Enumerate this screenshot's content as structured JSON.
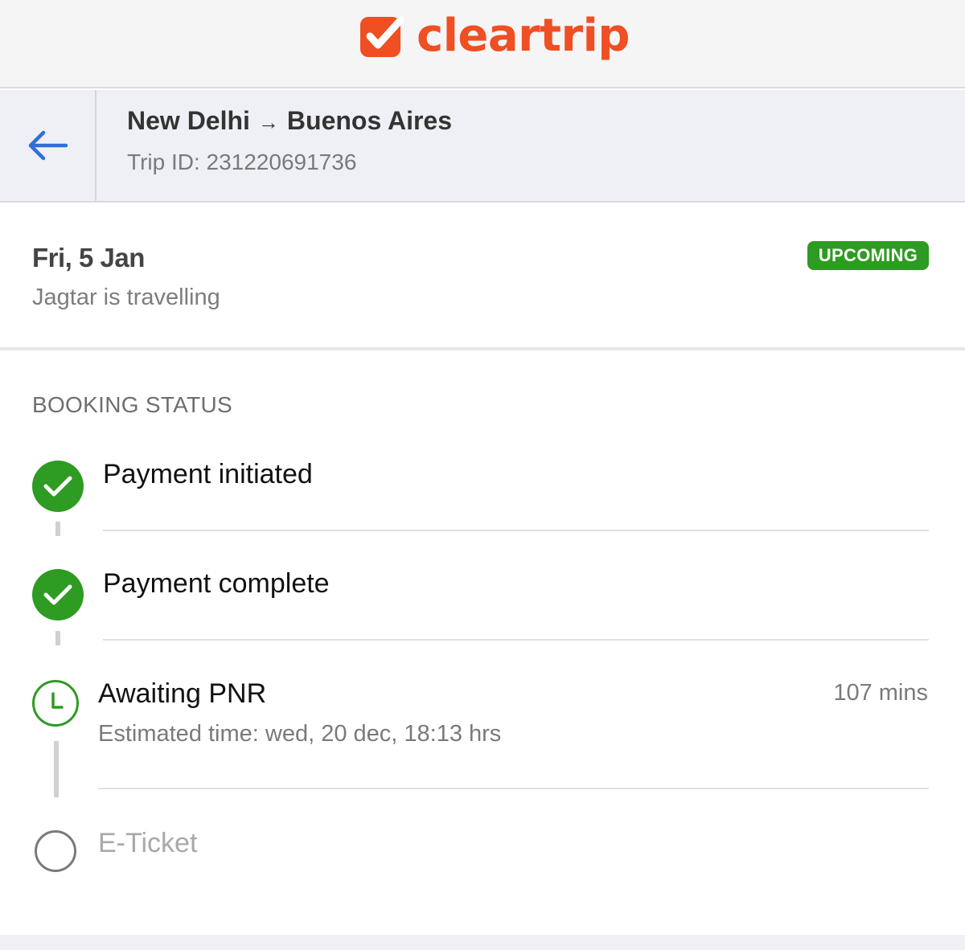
{
  "brand": {
    "name": "cleartrip",
    "color": "#f04e23",
    "logo_icon": "check-square-icon"
  },
  "trip": {
    "from": "New Delhi",
    "arrow": "→",
    "to": "Buenos Aires",
    "trip_id": "Trip ID: 231220691736",
    "back_icon": "arrow-left-icon"
  },
  "summary": {
    "date": "Fri, 5 Jan",
    "traveller": "Jagtar is travelling",
    "status_badge": "UPCOMING",
    "badge_color": "#2e9b22"
  },
  "booking_status": {
    "title": "BOOKING STATUS",
    "steps": [
      {
        "label": "Payment initiated",
        "state": "done",
        "icon": "check-circle-icon"
      },
      {
        "label": "Payment complete",
        "state": "done",
        "icon": "check-circle-icon"
      },
      {
        "label": "Awaiting PNR",
        "state": "pending",
        "icon": "clock-icon",
        "subtext": "Estimated time: wed, 20 dec, 18:13 hrs",
        "time_remaining": "107 mins"
      },
      {
        "label": "E-Ticket",
        "state": "todo",
        "icon": "empty-circle-icon"
      }
    ]
  }
}
